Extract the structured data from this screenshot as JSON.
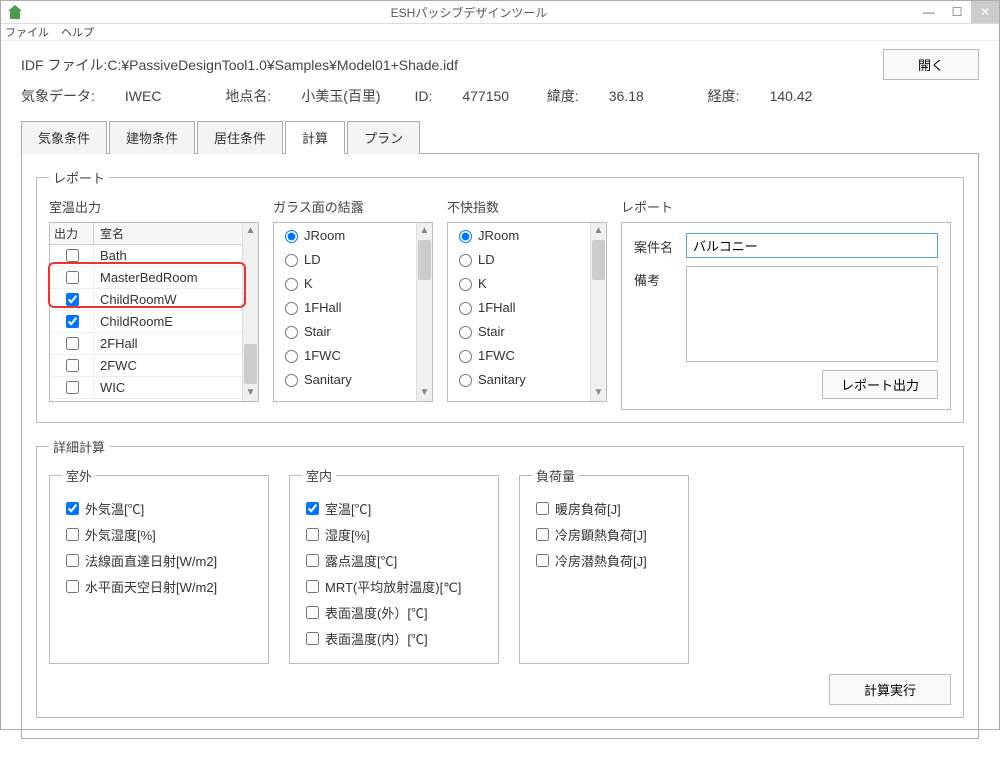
{
  "title": "ESHパッシブデザインツール",
  "menu": {
    "file": "ファイル",
    "help": "ヘルプ"
  },
  "idf": {
    "label_prefix": "IDF ファイル:",
    "path": "C:¥PassiveDesignTool1.0¥Samples¥Model01+Shade.idf",
    "open_btn": "開く"
  },
  "meta": {
    "weather_label": "気象データ:",
    "weather_value": "IWEC",
    "site_label": "地点名:",
    "site_value": "小美玉(百里)",
    "id_label": "ID:",
    "id_value": "477150",
    "lat_label": "緯度:",
    "lat_value": "36.18",
    "lon_label": "経度:",
    "lon_value": "140.42"
  },
  "tabs": [
    "気象条件",
    "建物条件",
    "居住条件",
    "計算",
    "プラン"
  ],
  "active_tab_index": 3,
  "report": {
    "legend": "レポート",
    "room_temp": {
      "header": "室温出力",
      "col_out": "出力",
      "col_name": "室名",
      "rows": [
        {
          "checked": false,
          "name": "Bath"
        },
        {
          "checked": false,
          "name": "MasterBedRoom"
        },
        {
          "checked": true,
          "name": "ChildRoomW"
        },
        {
          "checked": true,
          "name": "ChildRoomE"
        },
        {
          "checked": false,
          "name": "2FHall"
        },
        {
          "checked": false,
          "name": "2FWC"
        },
        {
          "checked": false,
          "name": "WIC"
        }
      ]
    },
    "condensation": {
      "header": "ガラス面の結露",
      "items": [
        "JRoom",
        "LD",
        "K",
        "1FHall",
        "Stair",
        "1FWC",
        "Sanitary"
      ],
      "selected_index": 0
    },
    "discomfort": {
      "header": "不快指数",
      "items": [
        "JRoom",
        "LD",
        "K",
        "1FHall",
        "Stair",
        "1FWC",
        "Sanitary"
      ],
      "selected_index": 0
    },
    "form": {
      "header": "レポート",
      "name_label": "案件名",
      "name_value": "バルコニー",
      "note_label": "備考",
      "note_value": "",
      "output_btn": "レポート出力"
    }
  },
  "detail": {
    "legend": "詳細計算",
    "outdoor": {
      "legend": "室外",
      "items": [
        {
          "checked": true,
          "label": "外気温[℃]"
        },
        {
          "checked": false,
          "label": "外気湿度[%]"
        },
        {
          "checked": false,
          "label": "法線面直達日射[W/m2]"
        },
        {
          "checked": false,
          "label": "水平面天空日射[W/m2]"
        }
      ]
    },
    "indoor": {
      "legend": "室内",
      "items": [
        {
          "checked": true,
          "label": "室温[℃]"
        },
        {
          "checked": false,
          "label": "湿度[%]"
        },
        {
          "checked": false,
          "label": "露点温度[℃]"
        },
        {
          "checked": false,
          "label": "MRT(平均放射温度)[℃]"
        },
        {
          "checked": false,
          "label": "表面温度(外）[℃]"
        },
        {
          "checked": false,
          "label": "表面温度(内）[℃]"
        }
      ]
    },
    "load": {
      "legend": "負荷量",
      "items": [
        {
          "checked": false,
          "label": "暖房負荷[J]"
        },
        {
          "checked": false,
          "label": "冷房顕熱負荷[J]"
        },
        {
          "checked": false,
          "label": "冷房潜熱負荷[J]"
        }
      ]
    },
    "calc_btn": "計算実行"
  }
}
